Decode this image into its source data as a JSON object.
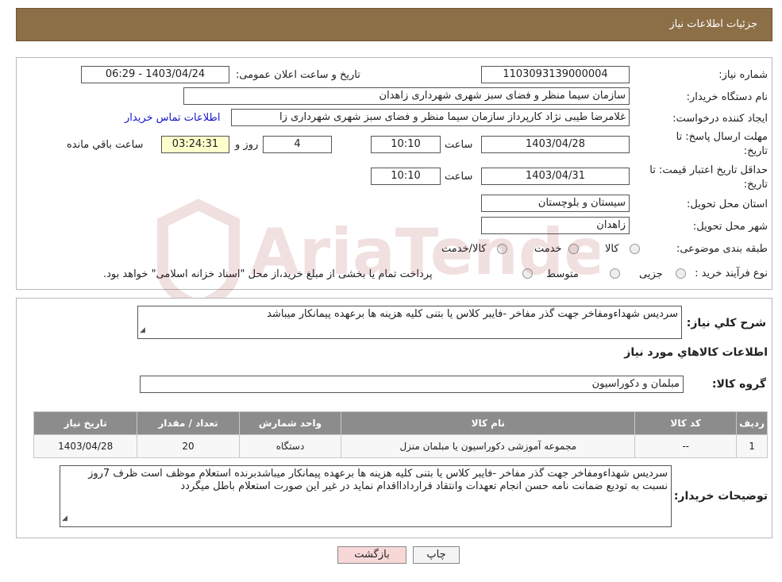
{
  "header": {
    "title": "جزئیات اطلاعات نیاز"
  },
  "form": {
    "need_number_label": "شماره نیاز:",
    "need_number": "1103093139000004",
    "announce_label": "تاریخ و ساعت اعلان عمومی:",
    "announce_value": "1403/04/24 - 06:29",
    "buyer_org_label": "نام دستگاه خریدار:",
    "buyer_org": "سازمان سیما منظر و فضای سبز شهری شهرداری زاهدان",
    "creator_label": "ایجاد کننده درخواست:",
    "creator": "غلامرضا طیبی نژاد کارپرداز سازمان سیما منظر و فضای سبز شهری شهرداری زا",
    "contact_link": "اطلاعات تماس خریدار",
    "deadline_label_1": "مهلت ارسال پاسخ: تا",
    "deadline_label_2": "تاریخ:",
    "deadline_date": "1403/04/28",
    "time_label": "ساعت",
    "deadline_time": "10:10",
    "days_value": "4",
    "days_label": "روز و",
    "remaining_time": "03:24:31",
    "remaining_label": "ساعت باقي مانده",
    "validity_label_1": "حداقل تاریخ اعتبار قیمت: تا",
    "validity_label_2": "تاریخ:",
    "validity_date": "1403/04/31",
    "validity_time": "10:10",
    "province_label": "استان محل تحویل:",
    "province": "سیستان و بلوچستان",
    "city_label": "شهر محل تحویل:",
    "city": "زاهدان",
    "category_label": "طبقه بندی موضوعی:",
    "category_options": [
      "کالا",
      "خدمت",
      "کالا/خدمت"
    ],
    "process_label": "نوع فرآیند خرید :",
    "process_options": [
      "جزیی",
      "متوسط"
    ],
    "payment_note": "پرداخت تمام یا بخشی از مبلغ خرید،از محل \"اسناد خزانه اسلامی\" خواهد بود."
  },
  "summary": {
    "label": "شرح کلي نياز:",
    "text": "سردیس شهداءومفاخر جهت گذر مفاخر -فایبر کلاس یا بتنی کلیه هزینه ها برعهده پیمانکار میباشد"
  },
  "goods": {
    "section_title": "اطلاعات کالاهاي مورد نياز",
    "group_label": "گروه کالا:",
    "group_value": "مبلمان و دکوراسیون",
    "columns": [
      "رديف",
      "کد کالا",
      "نام کالا",
      "واحد شمارش",
      "تعداد / مقدار",
      "تاريخ نياز"
    ],
    "rows": [
      [
        "1",
        "--",
        "مجموعه آموزشی دکوراسیون یا مبلمان منزل",
        "دستگاه",
        "20",
        "1403/04/28"
      ]
    ]
  },
  "buyer_notes": {
    "label": "توضیحات خریدار:",
    "text": "سردیس شهداءومفاخر جهت گذر مفاخر -فایبر کلاس یا بتنی کلیه هزینه ها برعهده پیمانکار میباشدبرنده استعلام موظف است ظرف 7روز نسبت به تودیع ضمانت نامه حسن انجام تعهدات وانتقاد قراردادااقدام نماید در غیر این صورت استعلام باطل میگردد"
  },
  "buttons": {
    "print": "چاپ",
    "back": "بازگشت"
  },
  "watermark_text": "AriaTender.neT"
}
